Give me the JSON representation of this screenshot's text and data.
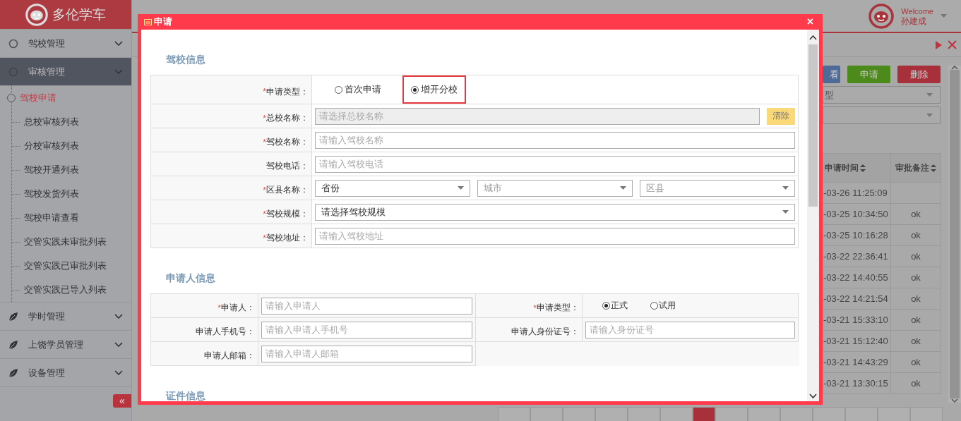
{
  "header": {
    "logo_text": "多伦学车",
    "welcome": "Welcome",
    "user": "孙建成"
  },
  "sidebar": {
    "groups": [
      {
        "label": "驾校管理",
        "kind": "circle",
        "selected": false
      },
      {
        "label": "审核管理",
        "kind": "circle",
        "selected": true,
        "children": [
          {
            "label": "驾校申请",
            "selected": true
          },
          {
            "label": "总校审核列表",
            "selected": false
          },
          {
            "label": "分校审核列表",
            "selected": false
          },
          {
            "label": "驾校开通列表",
            "selected": false
          },
          {
            "label": "驾校发货列表",
            "selected": false
          },
          {
            "label": "驾校申请查看",
            "selected": false
          },
          {
            "label": "交管实践未审批列表",
            "selected": false
          },
          {
            "label": "交管实践已审批列表",
            "selected": false
          },
          {
            "label": "交管实践已导入列表",
            "selected": false
          }
        ]
      },
      {
        "label": "学时管理",
        "kind": "leaf",
        "selected": false
      },
      {
        "label": "上饶学员管理",
        "kind": "leaf",
        "selected": false
      },
      {
        "label": "设备管理",
        "kind": "leaf",
        "selected": false
      }
    ],
    "collapse_button": "«"
  },
  "background": {
    "buttons": [
      {
        "label": "看",
        "kind": "blue"
      },
      {
        "label": "申请",
        "kind": "green"
      },
      {
        "label": "删除",
        "kind": "red"
      }
    ],
    "selects": [
      {
        "kind": "text",
        "placeholder": "型"
      },
      {
        "kind": "blank"
      }
    ],
    "table": {
      "columns": [
        {
          "label": "申请时间",
          "sortable": true
        },
        {
          "label": "审批备注",
          "sortable": true
        }
      ],
      "rows": [
        {
          "time": "-03-26 11:25:09"
        },
        {
          "time": "-03-25 10:34:50",
          "note": "ok"
        },
        {
          "time": "-03-25 10:16:28",
          "note": "ok"
        },
        {
          "time": "-03-22 22:36:41",
          "note": "ok"
        },
        {
          "time": "-03-22 14:40:55",
          "note": "ok"
        },
        {
          "time": "-03-22 14:21:54",
          "note": "ok"
        },
        {
          "time": "-03-21 15:33:10",
          "note": "ok"
        },
        {
          "time": "-03-21 15:12:40",
          "note": "ok"
        },
        {
          "time": "-03-21 14:43:29",
          "note": "ok"
        },
        {
          "time": "-03-21 13:30:15",
          "note": "ok"
        }
      ]
    },
    "pages": [
      {
        "selected": false
      },
      {
        "selected": false
      },
      {
        "selected": false
      },
      {
        "selected": false
      },
      {
        "selected": false
      },
      {
        "selected": false
      },
      {
        "selected": true
      },
      {
        "selected": false
      },
      {
        "selected": false
      },
      {
        "selected": false
      },
      {
        "selected": false
      },
      {
        "selected": false
      },
      {
        "selected": false
      },
      {
        "selected": false
      }
    ]
  },
  "modal": {
    "title": "申请",
    "close": "×",
    "sections": [
      {
        "title": "驾校信息",
        "kind": "single",
        "fields": [
          {
            "kind": "radio",
            "mark": "*",
            "label": "申请类型：",
            "options": [
              {
                "label": "首次申请",
                "selected": false,
                "highlighted": false
              },
              {
                "label": "增开分校",
                "selected": true,
                "highlighted": true
              }
            ]
          },
          {
            "kind": "readonly",
            "mark": "*",
            "label": "总校名称：",
            "placeholder": "请选择总校名称",
            "button": "清除"
          },
          {
            "kind": "input",
            "mark": "*",
            "label": "驾校名称：",
            "placeholder": "请输入驾校名称"
          },
          {
            "kind": "input",
            "label": "驾校电话：",
            "placeholder": "请输入驾校电话"
          },
          {
            "kind": "selects",
            "mark": "*",
            "label": "区县名称：",
            "selects": [
              {
                "value": "省份"
              },
              {
                "placeholder": "城市"
              },
              {
                "placeholder": "区县"
              }
            ]
          },
          {
            "kind": "select",
            "mark": "*",
            "label": "驾校规模：",
            "value": "请选择驾校规模"
          },
          {
            "kind": "input",
            "mark": "*",
            "label": "驾校地址：",
            "placeholder": "请输入驾校地址"
          }
        ]
      },
      {
        "title": "申请人信息",
        "kind": "double",
        "fields": [
          {
            "kind": "input",
            "mark": "*",
            "label": "申请人：",
            "placeholder": "请输入申请人"
          },
          {
            "kind": "radio",
            "mark": "*",
            "label": "申请类型：",
            "options": [
              {
                "label": "正式",
                "selected": true,
                "highlighted": false
              },
              {
                "label": "试用",
                "selected": false,
                "highlighted": false
              }
            ]
          },
          {
            "kind": "input",
            "label": "申请人手机号：",
            "placeholder": "请输入申请人手机号"
          },
          {
            "kind": "input",
            "label": "申请人身份证号：",
            "placeholder": "请输入身份证号"
          },
          {
            "kind": "input",
            "label": "申请人邮箱：",
            "placeholder": "请输入申请人邮箱"
          }
        ]
      },
      {
        "title": "证件信息"
      }
    ]
  }
}
